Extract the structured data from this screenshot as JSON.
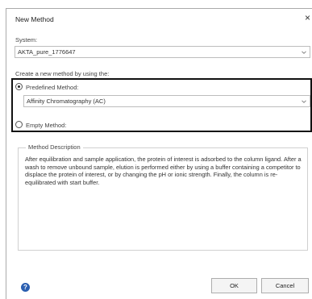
{
  "dialog": {
    "title": "New Method",
    "close_glyph": "×"
  },
  "system": {
    "label": "System:",
    "value": "AKTA_pure_1776647"
  },
  "create": {
    "label": "Create a new method by using the:"
  },
  "predefined": {
    "label": "Predefined Method:",
    "selected": true,
    "value": "Affinity Chromatography (AC)"
  },
  "empty": {
    "label": "Empty Method:",
    "selected": false
  },
  "description": {
    "title": "Method Description",
    "text": "After equilibration and sample application, the protein of interest is adsorbed to the column ligand. After a wash to remove unbound sample, elution is performed either by using a buffer containing a competitor to displace the protein of interest, or by changing the pH or ionic strength. Finally, the column is re-equilibrated with start buffer."
  },
  "footer": {
    "help_icon": "help-icon",
    "help_glyph": "?",
    "ok_label": "OK",
    "cancel_label": "Cancel"
  },
  "colors": {
    "highlight_border": "#111111",
    "help_icon": "#2b5fb0"
  }
}
